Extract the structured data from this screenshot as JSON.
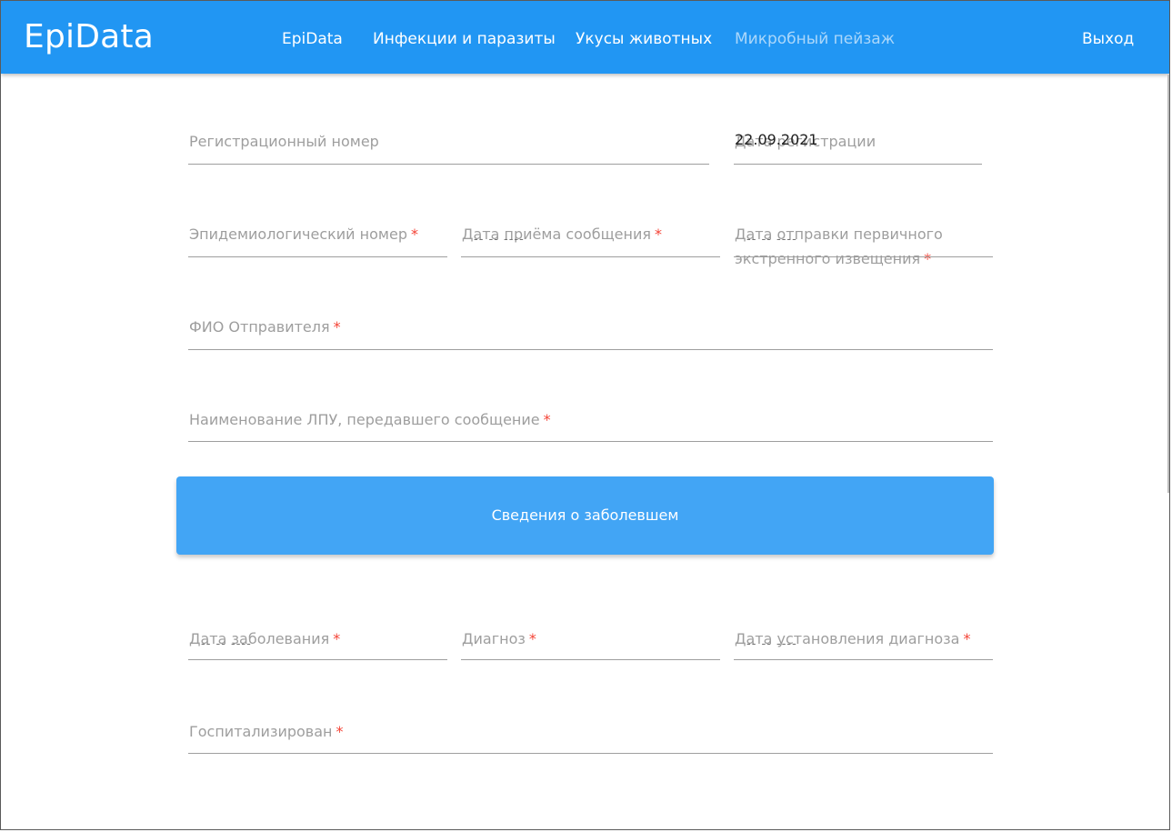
{
  "navbar": {
    "brand": "EpiData",
    "items": [
      {
        "label": "EpiData"
      },
      {
        "label": "Инфекции и паразиты"
      },
      {
        "label": "Укусы животных"
      },
      {
        "label": "Микробный пейзаж"
      }
    ],
    "logout": "Выход",
    "color": "#2196f3"
  },
  "form": {
    "registration_number": {
      "label": "Регистрационный номер",
      "value": ""
    },
    "registration_date": {
      "label": "Дата регистрации",
      "value": "22.09.2021"
    },
    "epidemiological_number": {
      "label": "Эпидемиологический номер",
      "required": "*"
    },
    "message_received_date": {
      "label": "Дата приёма сообщения",
      "required": "*"
    },
    "notification_sent_date": {
      "label": "Дата отправки первичного",
      "label_line2": "экстренного извещения",
      "required": "*"
    },
    "sender_name": {
      "label": "ФИО Отправителя",
      "required": "*"
    },
    "lpu_name": {
      "label": "Наименование ЛПУ, передавшего сообщение",
      "required": "*"
    },
    "patient_section_button": "Сведения о заболевшем",
    "disease_date": {
      "label": "Дата заболевания",
      "required": "*"
    },
    "diagnosis": {
      "label": "Диагноз",
      "required": "*"
    },
    "diagnosis_date": {
      "label": "Дата установления диагноза",
      "required": "*"
    },
    "hospitalized": {
      "label": "Госпитализирован",
      "required": "*"
    }
  }
}
